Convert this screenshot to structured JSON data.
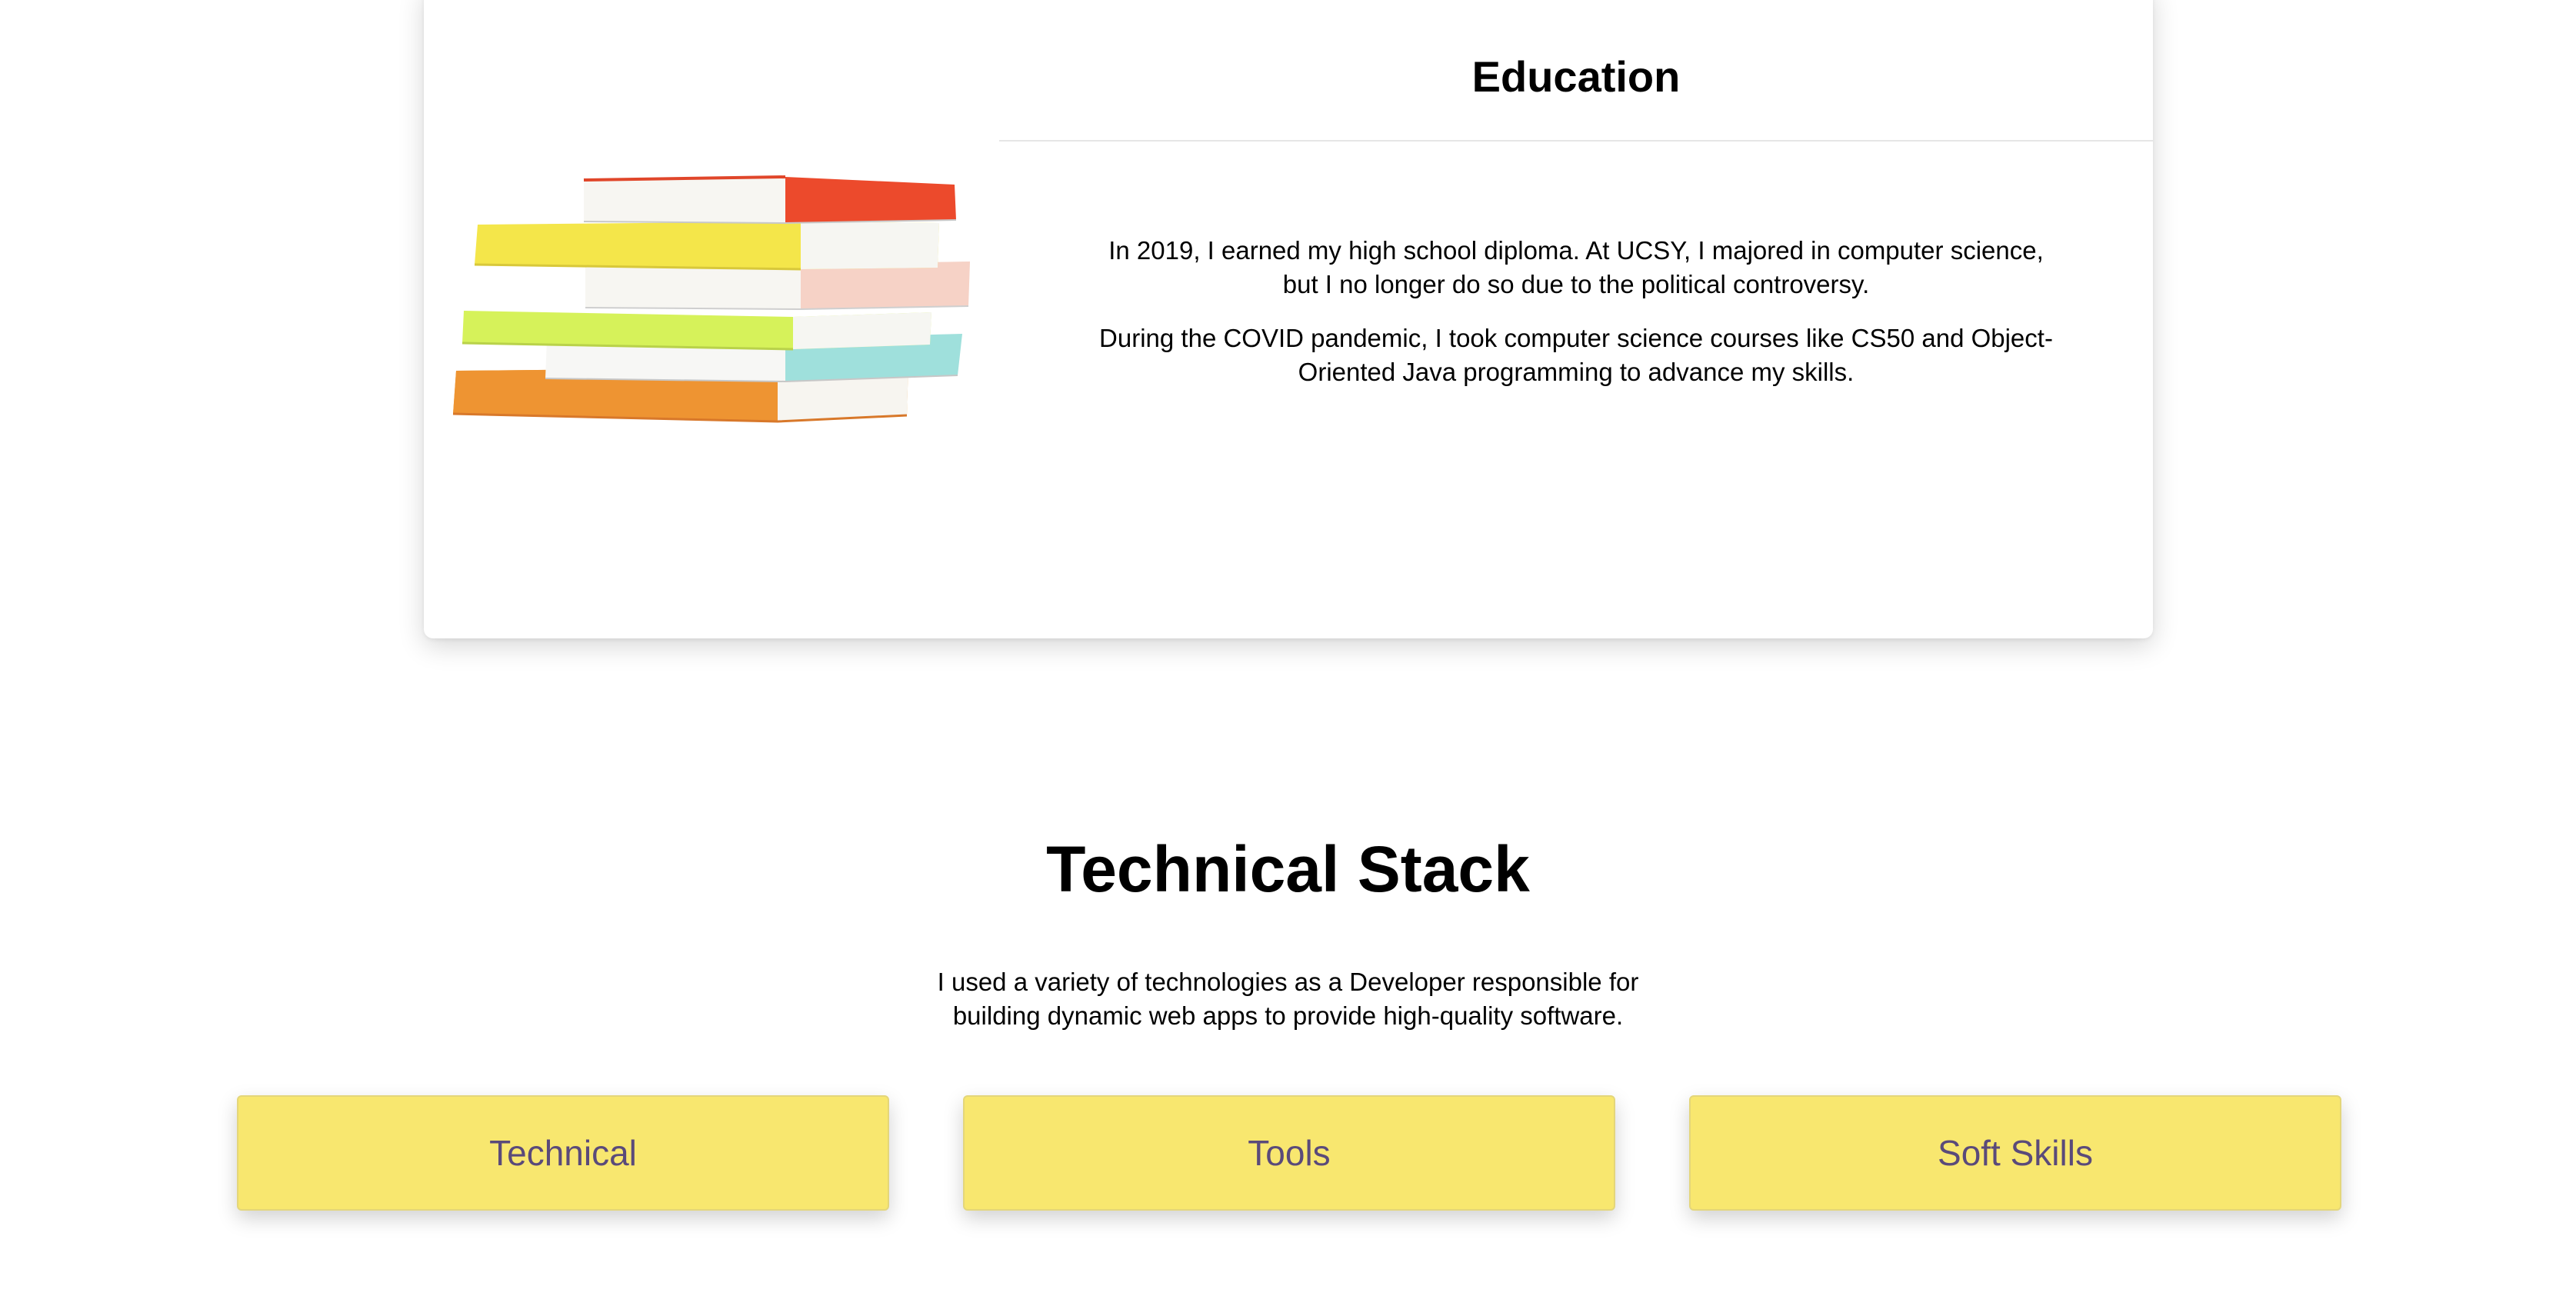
{
  "education": {
    "title": "Education",
    "image_alt": "books-stack",
    "paragraphs": [
      "In 2019, I earned my high school diploma. At UCSY, I majored in computer science, but I no longer do so due to the political controversy.",
      "During the COVID pandemic, I took computer science courses like CS50 and Object-Oriented Java programming to advance my skills."
    ]
  },
  "stack": {
    "title": "Technical Stack",
    "description": "I used a variety of technologies as a Developer responsible for building dynamic web apps to provide high-quality software.",
    "tabs": [
      {
        "label": "Technical"
      },
      {
        "label": "Tools"
      },
      {
        "label": "Soft Skills"
      }
    ]
  },
  "colors": {
    "tab_background": "#f8e76f",
    "tab_text": "#5a4a7a"
  }
}
